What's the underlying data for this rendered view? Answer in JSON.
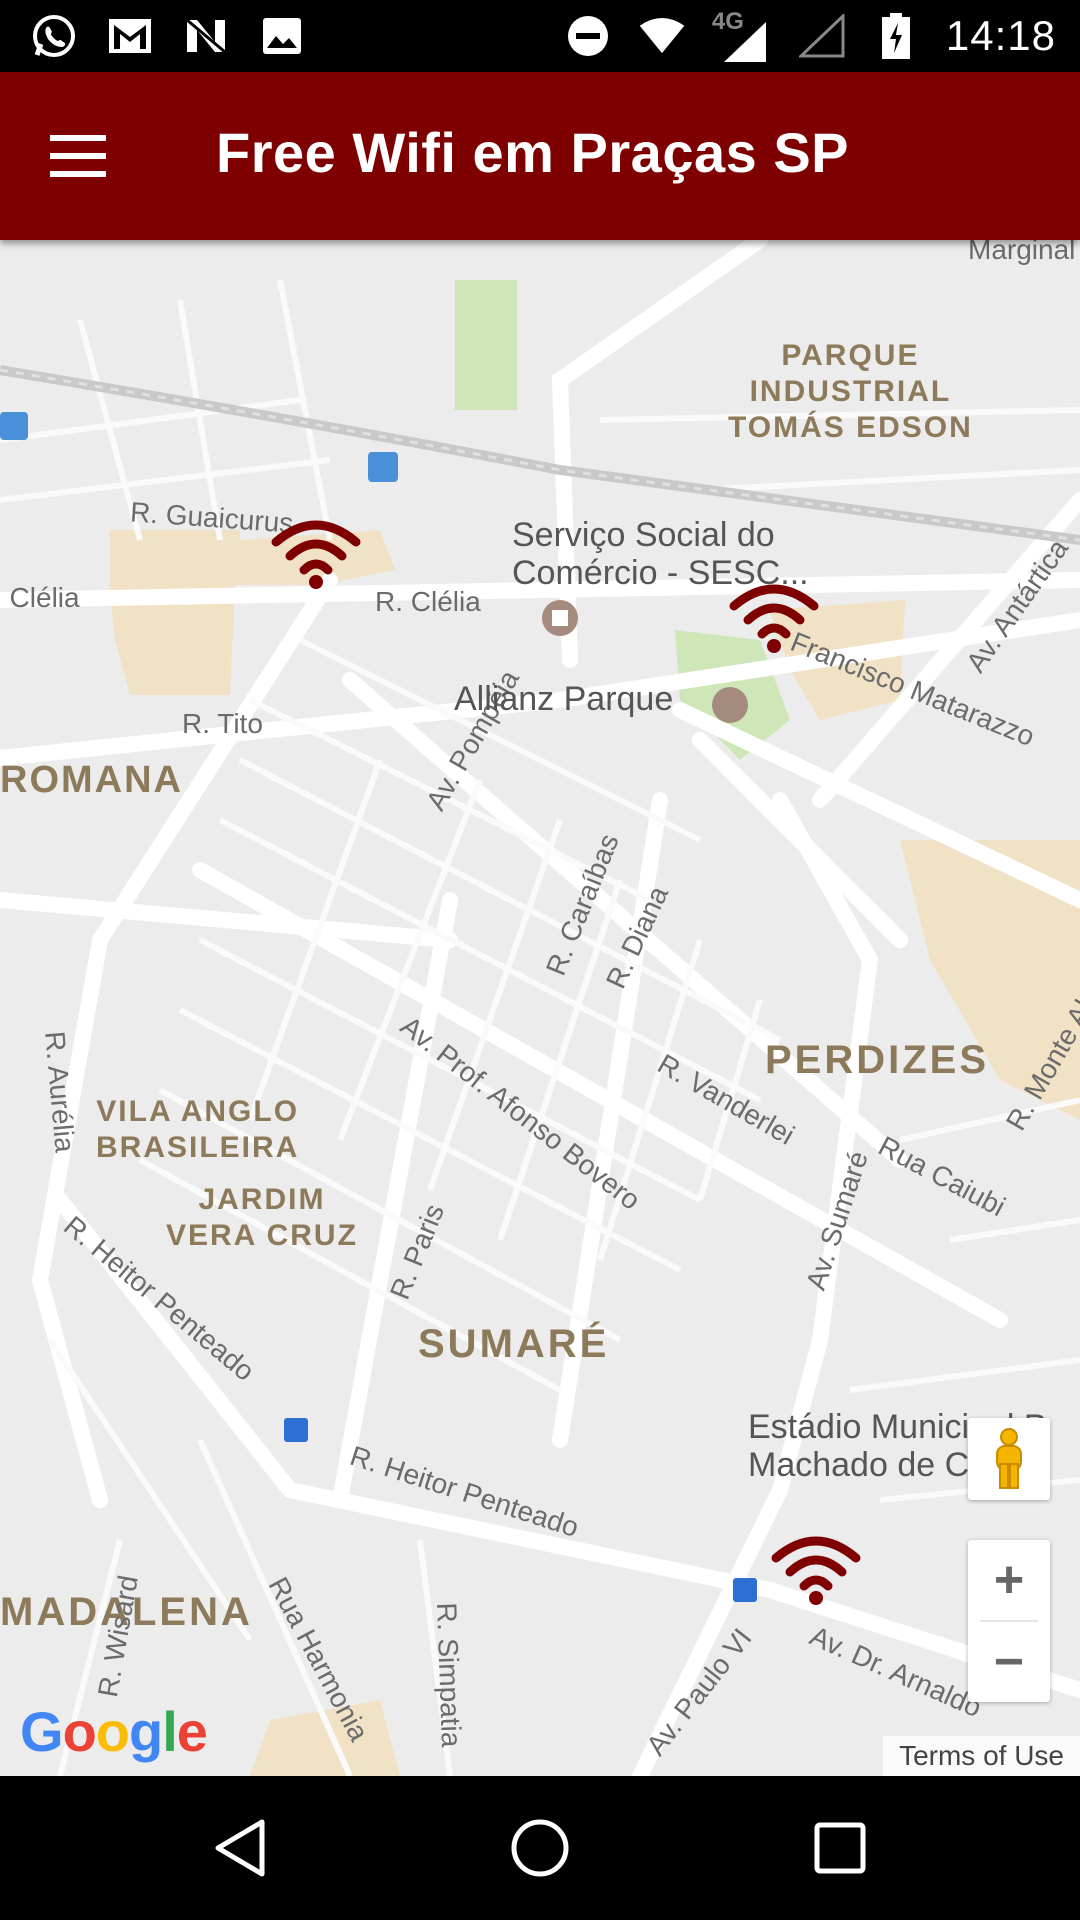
{
  "status_bar": {
    "time": "14:18",
    "network_label": "4G",
    "left_icons": [
      "whatsapp-icon",
      "gmail-icon",
      "n-app-icon",
      "image-icon"
    ],
    "right_icons": [
      "do-not-disturb-icon",
      "wifi-icon",
      "signal-icon",
      "signal-empty-icon",
      "battery-charging-icon"
    ]
  },
  "app_bar": {
    "title": "Free Wifi em Praças SP",
    "background": "#7f0000"
  },
  "map": {
    "districts": {
      "parque_industrial": "PARQUE\nINDUSTRIAL\nTOMÁS EDSON",
      "romana": "ROMANA",
      "perdizes": "PERDIZES",
      "vila_anglo": "VILA ANGLO\nBRASILEIRA",
      "jardim_vera_cruz": "JARDIM\nVERA CRUZ",
      "sumare": "SUMARÉ",
      "madalena": "MADALENA"
    },
    "streets": {
      "guaicurus": "R. Guaicurus",
      "clelia_left": ". Clélia",
      "clelia": "R. Clélia",
      "tito": "R. Tito",
      "pompeia": "Av. Pompéia",
      "caraibas": "R. Caraíbas",
      "diana": "R. Diana",
      "francisco_matarazzo": "Francisco Matarazzo",
      "antartica": "Av. Antártica",
      "prof_afonso_bovero": "Av. Prof. Afonso Bovero",
      "vanderlei": "R. Vanderlei",
      "sumare_av": "Av. Sumaré",
      "caiubi": "Rua Caiubi",
      "monte_alegre": "R. Monte Al",
      "aurelia": "R. Aurélia",
      "heitor_penteado_left": "R. Heitor Penteado",
      "heitor_penteado": "R. Heitor Penteado",
      "paris": "R. Paris",
      "harmonia": "Rua Harmonia",
      "simpatia": "R. Simpatia",
      "paulo_vi": "Av. Paulo VI",
      "dr_arnaldo": "Av. Dr. Arnaldo",
      "wisard": "R. Wisard",
      "marginal": "Marginal"
    },
    "pois": {
      "sesc": "Serviço Social do\nComércio - SESC...",
      "allianz": "Allianz Parque",
      "estadio": "Estádio Municipal P\nMachado de Carv"
    },
    "wifi_marker_color": "#7f0000",
    "wifi_markers_count": 3,
    "attribution": "Google",
    "terms": "Terms of Use",
    "zoom_in": "+",
    "zoom_out": "−"
  },
  "nav_bar": {
    "buttons": [
      "back-icon",
      "home-icon",
      "recents-icon"
    ]
  }
}
